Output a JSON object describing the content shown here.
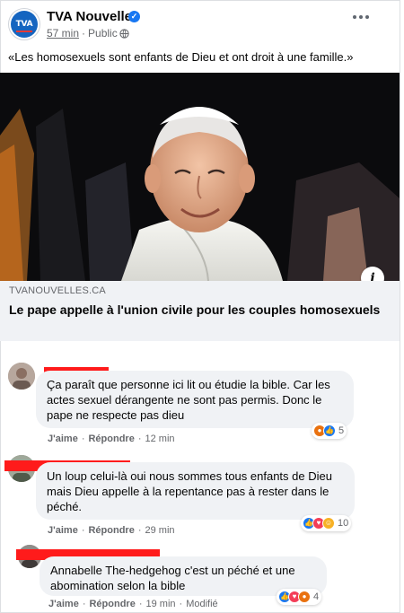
{
  "post": {
    "page_name": "TVA Nouvelles",
    "avatar_text": "TVA",
    "time": "57 min",
    "separator": "·",
    "audience": "Public",
    "text": "«Les homosexuels sont enfants de Dieu et ont droit à une famille.»"
  },
  "link_card": {
    "domain": "TVANOUVELLES.CA",
    "title": "Le pape appelle à l'union civile pour les couples homosexuels",
    "info_icon": "i"
  },
  "comments": [
    {
      "text": "Ça paraît que personne ici lit ou étudie la bible. Car les actes sexuel dérangente ne sont pas permis. Donc le pape ne respecte pas dieu",
      "like": "J'aime",
      "reply": "Répondre",
      "time": "12 min",
      "edited": "",
      "reactions": [
        "angry",
        "like"
      ],
      "count": "5"
    },
    {
      "text": "Un loup celui-là oui nous sommes tous enfants de Dieu mais Dieu appelle à la repentance pas à rester dans le péché.",
      "like": "J'aime",
      "reply": "Répondre",
      "time": "29 min",
      "edited": "",
      "reactions": [
        "like",
        "love",
        "haha"
      ],
      "count": "10"
    },
    {
      "text": "Annabelle The-hedgehog c'est un péché et une abomination selon la bible",
      "like": "J'aime",
      "reply": "Répondre",
      "time": "19 min",
      "edited": "Modifié",
      "reactions": [
        "like",
        "love",
        "angry"
      ],
      "count": "4"
    }
  ],
  "colors": {
    "brand_blue": "#1877f2",
    "redaction": "#ff1b1b",
    "bubble": "#f0f2f5"
  }
}
